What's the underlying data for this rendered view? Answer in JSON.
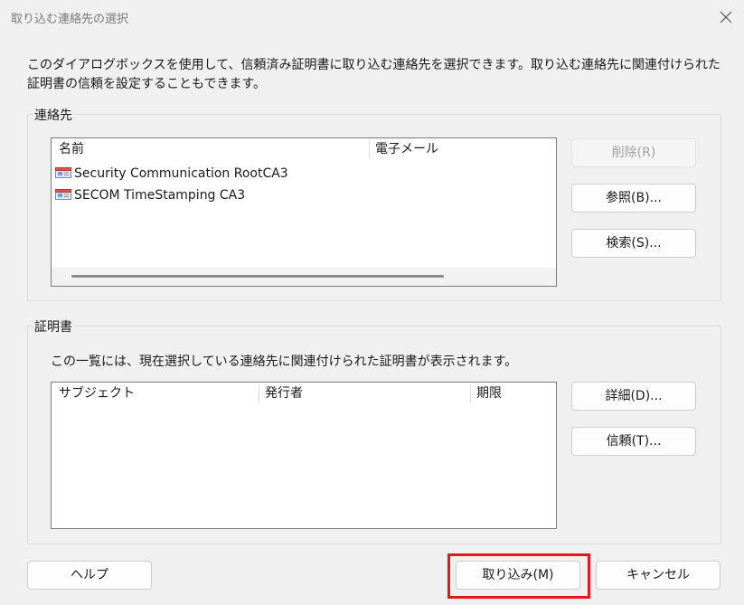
{
  "window": {
    "title": "取り込む連絡先の選択",
    "close_icon": "close-icon"
  },
  "intro_text": "このダイアログボックスを使用して、信頼済み証明書に取り込む連絡先を選択できます。取り込む連絡先に関連付けられた証明書の信頼を設定することもできます。",
  "contacts": {
    "label": "連絡先",
    "columns": [
      "名前",
      "電子メール"
    ],
    "rows": [
      {
        "name": "Security Communication RootCA3",
        "email": "",
        "icon": "certificate-icon"
      },
      {
        "name": "SECOM TimeStamping CA3",
        "email": "",
        "icon": "certificate-icon"
      }
    ],
    "buttons": {
      "delete": "削除(R)",
      "browse": "参照(B)...",
      "search": "検索(S)..."
    }
  },
  "certificates": {
    "label": "証明書",
    "description": "この一覧には、現在選択している連絡先に関連付けられた証明書が表示されます。",
    "columns": [
      "サブジェクト",
      "発行者",
      "期限"
    ],
    "rows": [],
    "buttons": {
      "details": "詳細(D)...",
      "trust": "信頼(T)..."
    }
  },
  "footer": {
    "help": "ヘルプ",
    "import": "取り込み(M)",
    "cancel": "キャンセル"
  },
  "colors": {
    "highlight": "#e8141e",
    "background": "#f0f0f0"
  }
}
